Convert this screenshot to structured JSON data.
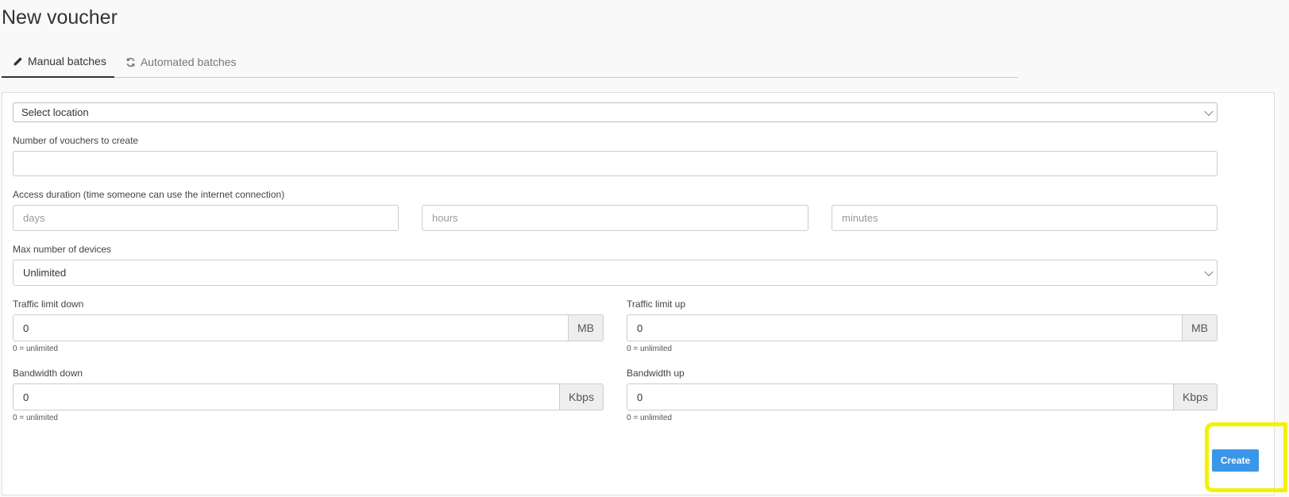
{
  "page": {
    "title": "New voucher"
  },
  "tabs": [
    {
      "label": "Manual batches",
      "icon": "pencil-icon",
      "active": true
    },
    {
      "label": "Automated batches",
      "icon": "refresh-icon",
      "active": false
    }
  ],
  "form": {
    "location": {
      "selected": "Select location"
    },
    "vouchers": {
      "label": "Number of vouchers to create",
      "value": ""
    },
    "duration": {
      "label": "Access duration (time someone can use the internet connection)",
      "days_placeholder": "days",
      "hours_placeholder": "hours",
      "minutes_placeholder": "minutes"
    },
    "devices": {
      "label": "Max number of devices",
      "selected": "Unlimited"
    },
    "traffic_down": {
      "label": "Traffic limit down",
      "value": "0",
      "unit": "MB",
      "hint": "0 = unlimited"
    },
    "traffic_up": {
      "label": "Traffic limit up",
      "value": "0",
      "unit": "MB",
      "hint": "0 = unlimited"
    },
    "bandwidth_down": {
      "label": "Bandwidth down",
      "value": "0",
      "unit": "Kbps",
      "hint": "0 = unlimited"
    },
    "bandwidth_up": {
      "label": "Bandwidth up",
      "value": "0",
      "unit": "Kbps",
      "hint": "0 = unlimited"
    },
    "create_label": "Create"
  },
  "colors": {
    "primary": "#3a96e8",
    "highlight": "#f2f200"
  }
}
